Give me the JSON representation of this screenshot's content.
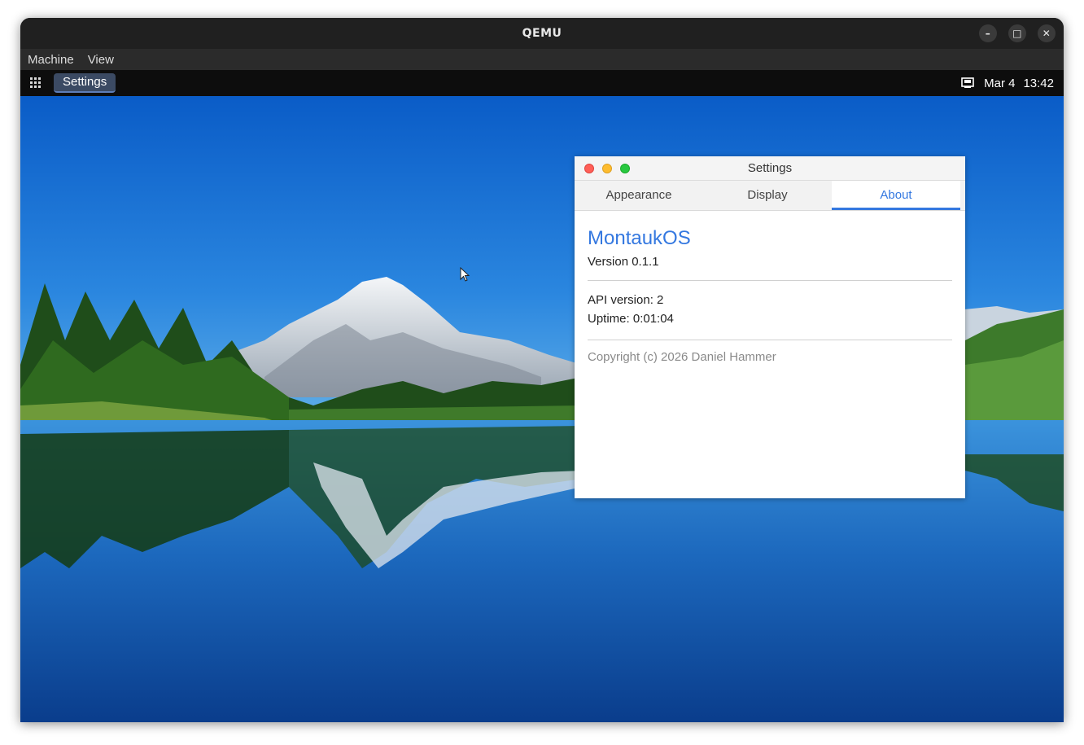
{
  "host": {
    "title": "QEMU",
    "controls": {
      "minimize": "–",
      "maximize": "□",
      "close": "✕"
    },
    "menu": [
      "Machine",
      "View"
    ]
  },
  "guest": {
    "taskbar": {
      "active_app": "Settings",
      "date": "Mar 4",
      "time": "13:42"
    }
  },
  "settings_window": {
    "title": "Settings",
    "tabs": [
      {
        "label": "Appearance",
        "active": false
      },
      {
        "label": "Display",
        "active": false
      },
      {
        "label": "About",
        "active": true
      }
    ],
    "about": {
      "product_name": "MontaukOS",
      "version": "Version 0.1.1",
      "api_version": "API version: 2",
      "uptime": "Uptime: 0:01:04",
      "copyright": "Copyright (c) 2026 Daniel Hammer"
    }
  },
  "colors": {
    "accent": "#3478e0",
    "close": "#ff5f57",
    "minimize": "#febc2e",
    "maximize": "#28c840"
  }
}
